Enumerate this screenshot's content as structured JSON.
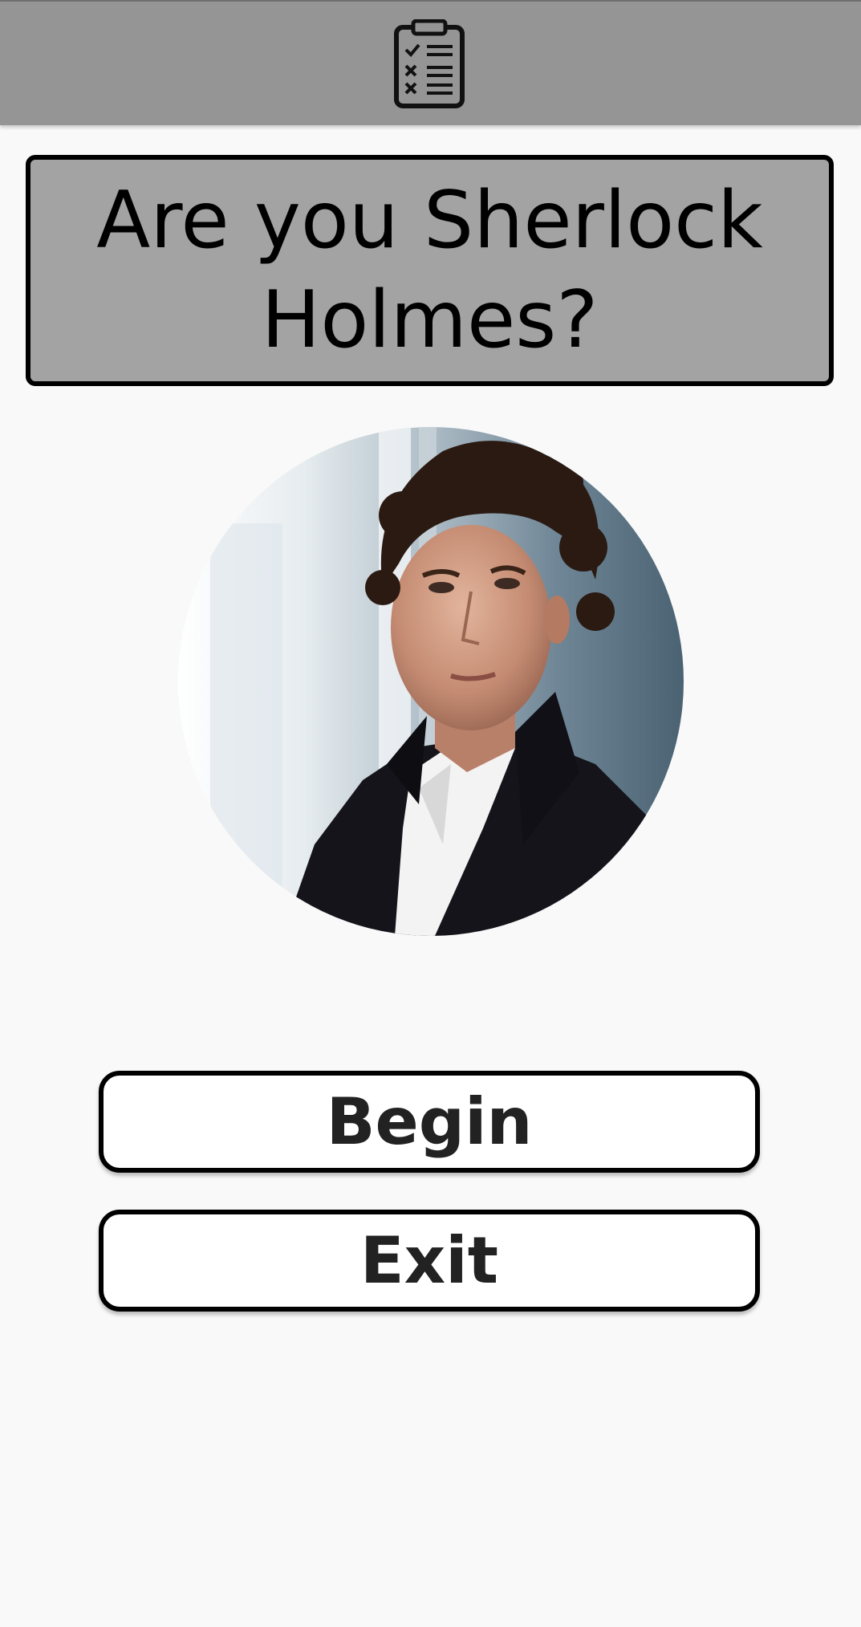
{
  "app_bar": {
    "icon": "clipboard-checklist-icon"
  },
  "question": {
    "text": "Are you Sherlock Holmes?"
  },
  "portrait": {
    "icon": "character-portrait"
  },
  "buttons": {
    "begin_label": "Begin",
    "exit_label": "Exit"
  },
  "colors": {
    "app_bar": "#959595",
    "question_box": "#a3a3a3",
    "background": "#f9f9f9",
    "button_bg": "#ffffff",
    "border": "#000000"
  }
}
